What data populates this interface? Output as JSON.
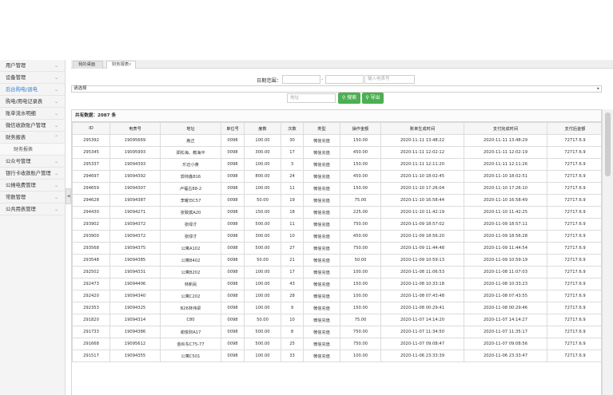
{
  "sidebar": {
    "items": [
      {
        "label": "用户管理",
        "active": false
      },
      {
        "label": "设备管理",
        "active": false
      },
      {
        "label": "后台购电/退电",
        "active": true
      },
      {
        "label": "购电/用电记录表",
        "active": false
      },
      {
        "label": "账单流水明细",
        "active": false
      },
      {
        "label": "微信收款账户管理",
        "active": false
      },
      {
        "label": "财务报表",
        "active": false,
        "expanded": true
      },
      {
        "label": "财务报表",
        "sub": true
      },
      {
        "label": "公众号管理",
        "active": false
      },
      {
        "label": "银行卡收款账户管理",
        "active": false
      },
      {
        "label": "公摊电费管理",
        "active": false
      },
      {
        "label": "常数管理",
        "active": false
      },
      {
        "label": "公共用表管理",
        "active": false
      }
    ]
  },
  "tabs": {
    "home": "我的桌面",
    "report": "财务报表",
    "close": "×"
  },
  "filters": {
    "date_label": "日期范围：",
    "date_start_placeholder": "",
    "date_end_placeholder": "",
    "dash": "-",
    "search_placeholder": "输入电表号",
    "select_value": "请选择",
    "address_placeholder": "地址",
    "search_button": "搜索",
    "export_button": "导出"
  },
  "table": {
    "total_label": "共有数据：",
    "total_value": "2087 条",
    "columns": [
      "ID",
      "电表号",
      "地址",
      "单位号",
      "度数",
      "次数",
      "类型",
      "操作金额",
      "账单生成时间",
      "支付完成时间",
      "支付后金额"
    ],
    "rows": [
      [
        "295392",
        "19095669",
        "嵩正",
        "0098",
        "100.00",
        "30",
        "微信充值",
        "150.00",
        "2020-11-11 13:48:22",
        "2020-11-11 13:48:29",
        "72717.6.9"
      ],
      [
        "295345",
        "19095993",
        "郑松海、教海平",
        "0098",
        "300.00",
        "17",
        "微信充值",
        "450.00",
        "2020-11-11 12:02:12",
        "2020-11-11 12:02:19",
        "72717.6.9"
      ],
      [
        "295337",
        "19094393",
        "乐迈小黄",
        "0098",
        "100.00",
        "3",
        "微信充值",
        "150.00",
        "2020-11-11 12:11:20",
        "2020-11-11 12:11:26",
        "72717.6.9"
      ],
      [
        "294697",
        "19094392",
        "郭帅鑫816",
        "0098",
        "800.00",
        "24",
        "微信充值",
        "450.00",
        "2020-11-10 18:02:45",
        "2020-11-10 18:02:51",
        "72717.6.9"
      ],
      [
        "294659",
        "19094307",
        "卢福古88-2",
        "0098",
        "100.00",
        "11",
        "微信充值",
        "150.00",
        "2020-11-10 17:26:04",
        "2020-11-10 17:26:10",
        "72717.6.9"
      ],
      [
        "294628",
        "19094387",
        "李耀日C57",
        "0098",
        "50.00",
        "19",
        "微信充值",
        "75.00",
        "2020-11-10 16:58:44",
        "2020-11-10 16:58:49",
        "72717.6.9"
      ],
      [
        "294430",
        "19094271",
        "张致斌A20",
        "0098",
        "150.00",
        "18",
        "微信充值",
        "225.00",
        "2020-11-10 11:42:19",
        "2020-11-10 11:42:25",
        "72717.6.9"
      ],
      [
        "293902",
        "19094372",
        "张绿才",
        "0098",
        "500.00",
        "11",
        "微信充值",
        "750.00",
        "2020-11-09 18:57:02",
        "2020-11-09 18:57:11",
        "72717.6.9"
      ],
      [
        "293900",
        "19094372",
        "张绿才",
        "0098",
        "300.00",
        "10",
        "微信充值",
        "450.00",
        "2020-11-09 18:56:20",
        "2020-11-09 18:56:28",
        "72717.6.9"
      ],
      [
        "293568",
        "19094375",
        "公寓A102",
        "0098",
        "500.00",
        "27",
        "微信充值",
        "750.00",
        "2020-11-09 11:44:48",
        "2020-11-09 11:44:54",
        "72717.6.9"
      ],
      [
        "293548",
        "19094385",
        "公寓B402",
        "0098",
        "50.00",
        "21",
        "微信充值",
        "50.00",
        "2020-11-09 10:59:13",
        "2020-11-09 10:59:19",
        "72717.6.9"
      ],
      [
        "292502",
        "19094331",
        "公寓B202",
        "0098",
        "100.00",
        "17",
        "微信充值",
        "100.00",
        "2020-11-08 11:06:53",
        "2020-11-08 11:07:03",
        "72717.6.9"
      ],
      [
        "292473",
        "19094406",
        "林新民",
        "0098",
        "100.00",
        "43",
        "微信充值",
        "150.00",
        "2020-11-08 10:33:18",
        "2020-11-08 10:33:23",
        "72717.6.9"
      ],
      [
        "292420",
        "19094340",
        "公寓C202",
        "0098",
        "100.00",
        "28",
        "微信充值",
        "100.00",
        "2020-11-08 07:43:48",
        "2020-11-08 07:43:55",
        "72717.6.9"
      ],
      [
        "292353",
        "19094325",
        "B26林伟梁",
        "0098",
        "100.00",
        "9",
        "微信充值",
        "150.00",
        "2020-11-08 00:29:41",
        "2020-11-08 00:29:46",
        "72717.6.9"
      ],
      [
        "291820",
        "19094314",
        "C80",
        "0098",
        "50.00",
        "10",
        "微信充值",
        "75.00",
        "2020-11-07 14:14:20",
        "2020-11-07 14:14:27",
        "72717.6.9"
      ],
      [
        "291733",
        "19094386",
        "谢俊财A17",
        "0098",
        "500.00",
        "8",
        "微信充值",
        "750.00",
        "2020-11-07 11:34:50",
        "2020-11-07 11:35:17",
        "72717.6.9"
      ],
      [
        "291668",
        "19095612",
        "金岭东C75-77",
        "0098",
        "500.00",
        "25",
        "微信充值",
        "750.00",
        "2020-11-07 09:08:47",
        "2020-11-07 09:08:56",
        "72717.6.9"
      ],
      [
        "291517",
        "19094355",
        "公寓C501",
        "0098",
        "100.00",
        "33",
        "微信充值",
        "100.00",
        "2020-11-06 23:33:39",
        "2020-11-06 23:33:47",
        "72717.6.9"
      ]
    ]
  },
  "icons": {
    "chevron": "chevron-down-icon",
    "search": "search-icon",
    "export": "export-icon",
    "collapse": "arrow-left-icon"
  },
  "colors": {
    "accent": "#4cb050",
    "active_menu": "#2f7fd1"
  }
}
